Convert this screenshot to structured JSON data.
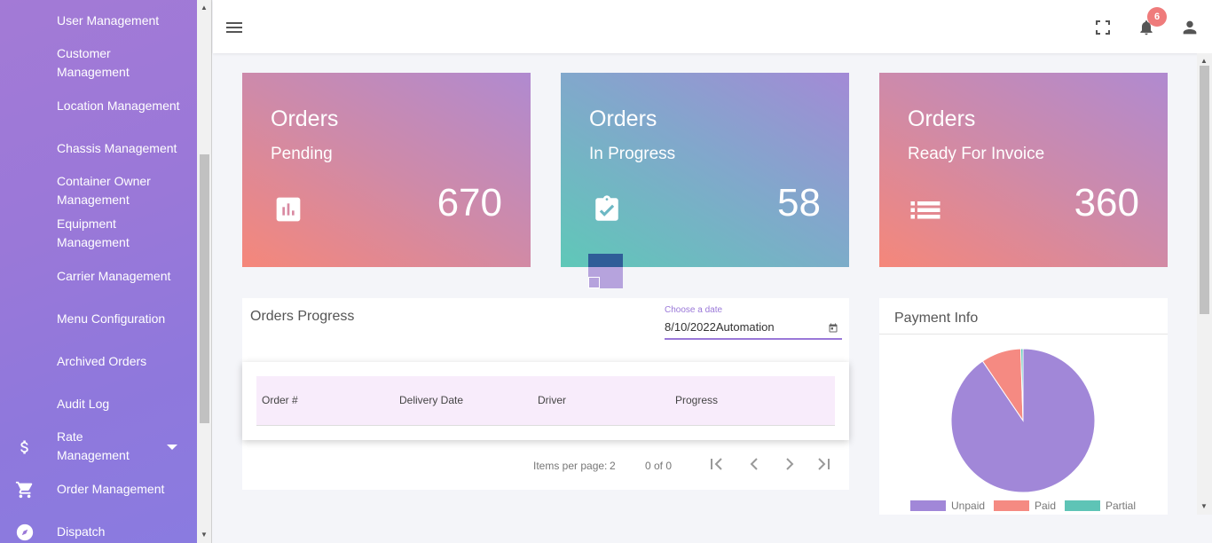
{
  "sidebar": {
    "items": [
      {
        "label": "User Management"
      },
      {
        "label": "Customer Management"
      },
      {
        "label": "Location Management"
      },
      {
        "label": "Chassis Management"
      },
      {
        "label": "Container Owner Management"
      },
      {
        "label": "Equipment Management"
      },
      {
        "label": "Carrier Management"
      },
      {
        "label": "Menu Configuration"
      },
      {
        "label": "Archived Orders"
      },
      {
        "label": "Audit Log"
      },
      {
        "label": "Rate Management",
        "icon": "dollar-icon"
      },
      {
        "label": "Order Management",
        "icon": "cart-icon"
      },
      {
        "label": "Dispatch",
        "icon": "compass-icon"
      }
    ]
  },
  "topbar": {
    "notification_count": "6",
    "icons": [
      "menu-icon",
      "fullscreen-icon",
      "bell-icon",
      "account-icon"
    ]
  },
  "cards": [
    {
      "title": "Orders",
      "subtitle": "Pending",
      "value": "670",
      "icon": "bar-chart-icon"
    },
    {
      "title": "Orders",
      "subtitle": "In Progress",
      "value": "58",
      "icon": "clipboard-check-icon"
    },
    {
      "title": "Orders",
      "subtitle": "Ready For Invoice",
      "value": "360",
      "icon": "list-icon"
    }
  ],
  "orders_progress": {
    "title": "Orders Progress",
    "date_label": "Choose a date",
    "date_value": "8/10/2022Automation",
    "columns": [
      "Order #",
      "Delivery Date",
      "Driver",
      "Progress"
    ],
    "items_per_page_label": "Items per page:",
    "items_per_page": "2",
    "range": "0 of 0"
  },
  "payment_info": {
    "title": "Payment Info",
    "chart_data": {
      "type": "pie",
      "categories": [
        "Unpaid",
        "Paid",
        "Partial"
      ],
      "values": [
        90.5,
        9,
        0.5
      ],
      "colors": [
        "#a187d8",
        "#f58a82",
        "#5ec4b6"
      ]
    }
  }
}
